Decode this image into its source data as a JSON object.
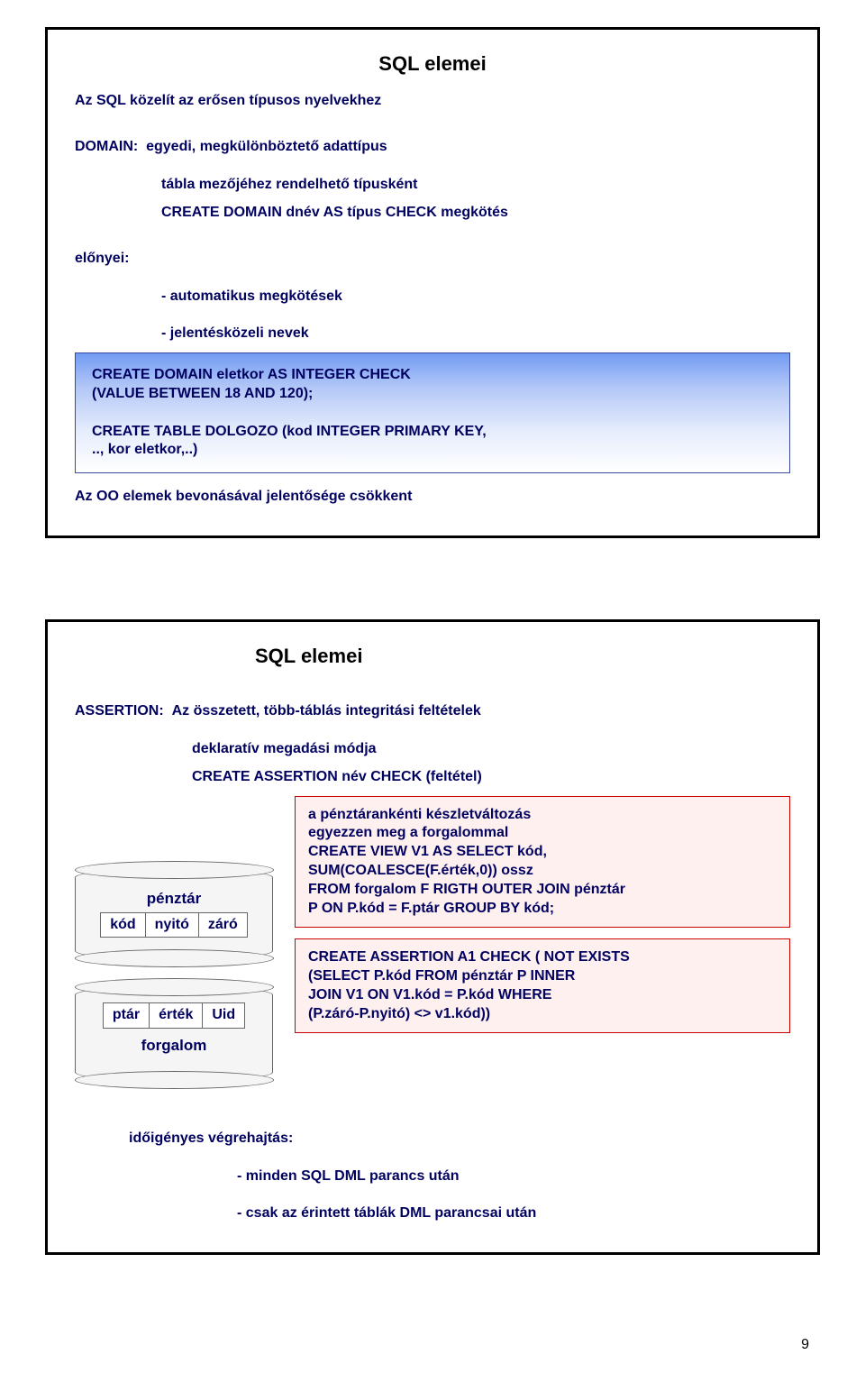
{
  "slide1": {
    "title": "SQL elemei",
    "intro": "Az SQL közelít az erősen típusos nyelvekhez",
    "domain_label": "DOMAIN:",
    "domain_desc1": "egyedi, megkülönböztető adattípus",
    "domain_desc2": "tábla mezőjéhez rendelhető típusként",
    "create_domain_syntax": "CREATE DOMAIN dnév AS típus CHECK megkötés",
    "adv_label": "előnyei:",
    "adv1": "- automatikus megkötések",
    "adv2": "- jelentésközeli nevek",
    "code_box": "CREATE DOMAIN eletkor AS INTEGER CHECK\n(VALUE BETWEEN 18 AND 120);\n\nCREATE TABLE DOLGOZO (kod INTEGER PRIMARY KEY,\n.., kor eletkor,..)",
    "footer": "Az OO elemek bevonásával jelentősége csökkent"
  },
  "slide2": {
    "title": "SQL elemei",
    "assert_label": "ASSERTION:",
    "assert_desc1": "Az összetett, több-táblás integritási feltételek",
    "assert_desc2": "deklaratív megadási módja",
    "assert_syntax": "CREATE ASSERTION név CHECK (feltétel)",
    "db1_name": "pénztár",
    "db1_cols": [
      "kód",
      "nyitó",
      "záró"
    ],
    "db2_name": "forgalom",
    "db2_cols": [
      "ptár",
      "érték",
      "Uid"
    ],
    "pink1": "a pénztárankénti készletváltozás\negyezzen meg a forgalommal\nCREATE VIEW V1 AS SELECT kód,\nSUM(COALESCE(F.érték,0)) ossz\nFROM forgalom F RIGTH OUTER JOIN pénztár\nP ON P.kód = F.ptár GROUP BY kód;",
    "pink2": "CREATE ASSERTION A1 CHECK ( NOT EXISTS\n(SELECT P.kód FROM pénztár P INNER\nJOIN V1 ON V1.kód = P.kód WHERE\n(P.záró-P.nyitó) <> v1.kód))",
    "exec_label": "időigényes végrehajtás:",
    "exec1": "- minden SQL DML parancs után",
    "exec2": "- csak az érintett táblák DML parancsai után"
  },
  "page_number": "9"
}
